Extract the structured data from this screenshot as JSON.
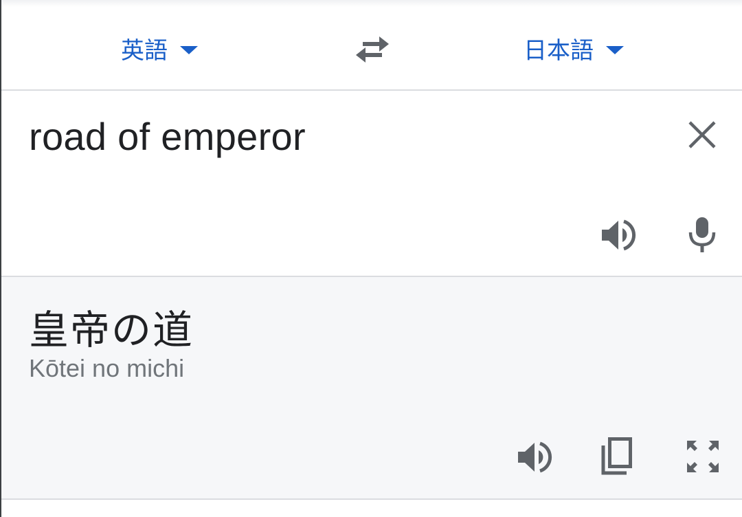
{
  "languages": {
    "source": "英語",
    "target": "日本語"
  },
  "input": {
    "text": "road of emperor"
  },
  "output": {
    "translation": "皇帝の道",
    "romanization": "Kōtei no michi"
  },
  "icons": {
    "swap": "swap-arrows-icon",
    "clear": "close-icon",
    "input_listen": "speaker-icon",
    "mic": "microphone-icon",
    "output_listen": "speaker-icon",
    "copy": "copy-icon",
    "fullscreen": "fullscreen-icon"
  },
  "colors": {
    "accent": "#1a5fc8",
    "icon": "#5f6368",
    "output_background": "#f6f7f9",
    "divider": "#dadce0"
  }
}
